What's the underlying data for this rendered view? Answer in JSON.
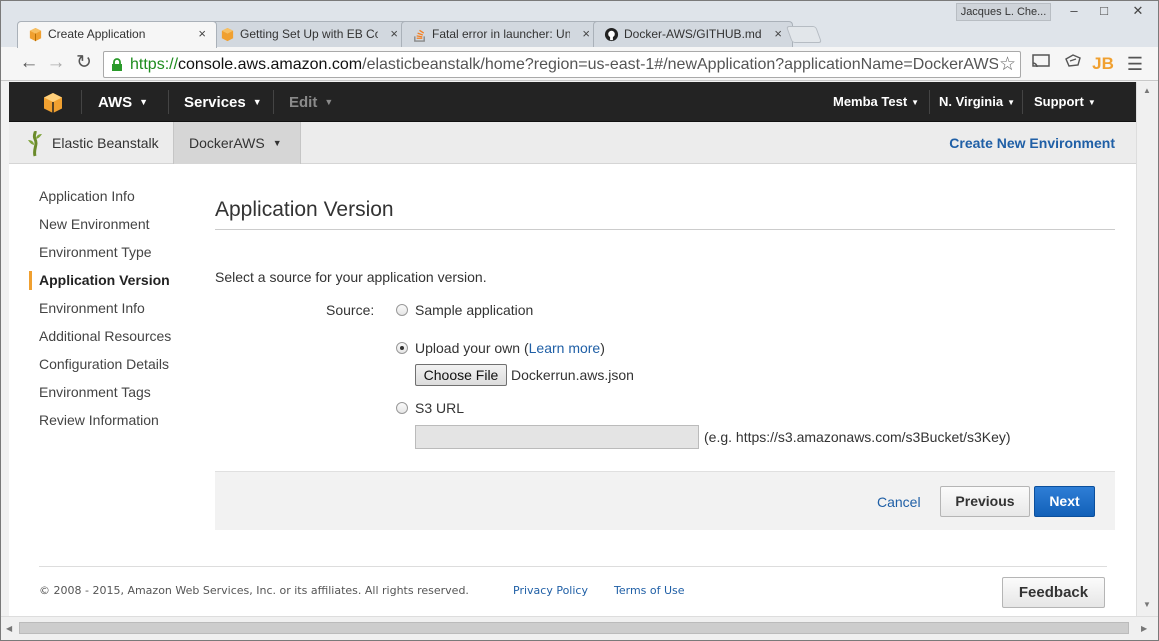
{
  "browser": {
    "user_name": "Jacques L. Che...",
    "window_controls": {
      "minimize": "–",
      "maximize": "□",
      "close": "✕"
    },
    "tabs": [
      {
        "label": "Create Application",
        "icon": "aws-cube-icon",
        "active": true
      },
      {
        "label": "Getting Set Up with EB Co",
        "icon": "aws-cube-icon",
        "active": false
      },
      {
        "label": "Fatal error in launcher: Un",
        "icon": "stackoverflow-icon",
        "active": false
      },
      {
        "label": "Docker-AWS/GITHUB.md",
        "icon": "github-icon",
        "active": false
      }
    ],
    "tab_close": "×",
    "url_scheme": "https://",
    "url_host": "console.aws.amazon.com",
    "url_path": "/elasticbeanstalk/home?region=us-east-1#/newApplication?applicationName=DockerAWS",
    "toolbar_icons": [
      "back-arrow-icon",
      "forward-arrow-icon",
      "reload-icon",
      "bookmark-star-icon",
      "cast-icon",
      "pocket-icon",
      "jetbrains-icon",
      "menu-icon"
    ],
    "jb_label": "JB"
  },
  "aws_nav": {
    "aws_label": "AWS",
    "services_label": "Services",
    "edit_label": "Edit",
    "account_label": "Memba Test",
    "region_label": "N. Virginia",
    "support_label": "Support",
    "caret": "▼"
  },
  "eb_bar": {
    "service_name": "Elastic Beanstalk",
    "app_name": "DockerAWS",
    "create_env_label": "Create New Environment"
  },
  "sidenav": {
    "items": [
      {
        "label": "Application Info",
        "active": false
      },
      {
        "label": "New Environment",
        "active": false
      },
      {
        "label": "Environment Type",
        "active": false
      },
      {
        "label": "Application Version",
        "active": true
      },
      {
        "label": "Environment Info",
        "active": false
      },
      {
        "label": "Additional Resources",
        "active": false
      },
      {
        "label": "Configuration Details",
        "active": false
      },
      {
        "label": "Environment Tags",
        "active": false
      },
      {
        "label": "Review Information",
        "active": false
      }
    ]
  },
  "main": {
    "title": "Application Version",
    "intro": "Select a source for your application version.",
    "source_label": "Source:",
    "options": {
      "sample": {
        "label": "Sample application",
        "checked": false
      },
      "upload": {
        "label_prefix": "Upload your own (",
        "link": "Learn more",
        "label_suffix": ")",
        "checked": true
      },
      "s3": {
        "label": "S3 URL",
        "checked": false
      }
    },
    "choose_file_label": "Choose File",
    "chosen_file": "Dockerrun.aws.json",
    "s3_value": "",
    "s3_hint": "(e.g. https://s3.amazonaws.com/s3Bucket/s3Key)",
    "cancel_label": "Cancel",
    "previous_label": "Previous",
    "next_label": "Next"
  },
  "footer": {
    "copyright": "© 2008 - 2015, Amazon Web Services, Inc. or its affiliates. All rights reserved.",
    "privacy_label": "Privacy Policy",
    "terms_label": "Terms of Use",
    "feedback_label": "Feedback"
  },
  "colors": {
    "aws_header": "#232323",
    "aws_orange": "#f0a030",
    "link_blue": "#1f5fa6",
    "primary_button": "#1a6cc6"
  }
}
